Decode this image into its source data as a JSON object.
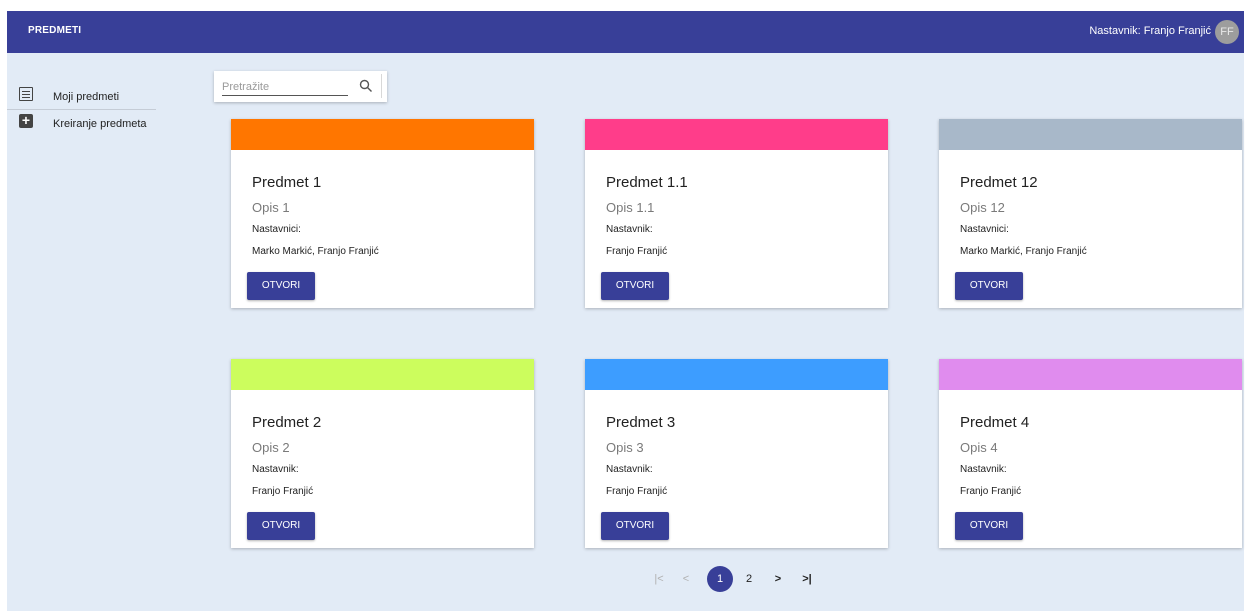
{
  "header": {
    "title": "PREDMETI",
    "user_label": "Nastavnik: Franjo Franjić",
    "avatar_initials": "FF"
  },
  "sidebar": {
    "items": [
      {
        "label": "Moji predmeti",
        "icon": "list-icon"
      },
      {
        "label": "Kreiranje predmeta",
        "icon": "add-box-icon"
      }
    ]
  },
  "search": {
    "placeholder": "Pretražite",
    "value": ""
  },
  "cards": [
    {
      "name": "Predmet 1",
      "desc": "Opis 1",
      "teacher_label": "Nastavnici:",
      "teachers": "Marko Markić, Franjo Franjić",
      "button": "OTVORI",
      "color": "#ff7600"
    },
    {
      "name": "Predmet 1.1",
      "desc": "Opis 1.1",
      "teacher_label": "Nastavnik:",
      "teachers": "Franjo Franjić",
      "button": "OTVORI",
      "color": "#ff3d8a"
    },
    {
      "name": "Predmet 12",
      "desc": "Opis 12",
      "teacher_label": "Nastavnici:",
      "teachers": "Marko Markić, Franjo Franjić",
      "button": "OTVORI",
      "color": "#a8b8c9"
    },
    {
      "name": "Predmet 2",
      "desc": "Opis 2",
      "teacher_label": "Nastavnik:",
      "teachers": "Franjo Franjić",
      "button": "OTVORI",
      "color": "#ccfd5d"
    },
    {
      "name": "Predmet 3",
      "desc": "Opis 3",
      "teacher_label": "Nastavnik:",
      "teachers": "Franjo Franjić",
      "button": "OTVORI",
      "color": "#3d9dff"
    },
    {
      "name": "Predmet 4",
      "desc": "Opis 4",
      "teacher_label": "Nastavnik:",
      "teachers": "Franjo Franjić",
      "button": "OTVORI",
      "color": "#e08cee"
    }
  ],
  "pagination": {
    "first": "|<",
    "prev": "<",
    "pages": [
      "1",
      "2"
    ],
    "active_page": "1",
    "next": ">",
    "last": ">|"
  },
  "colors": {
    "primary": "#383f98",
    "background": "#e2ebf6"
  }
}
